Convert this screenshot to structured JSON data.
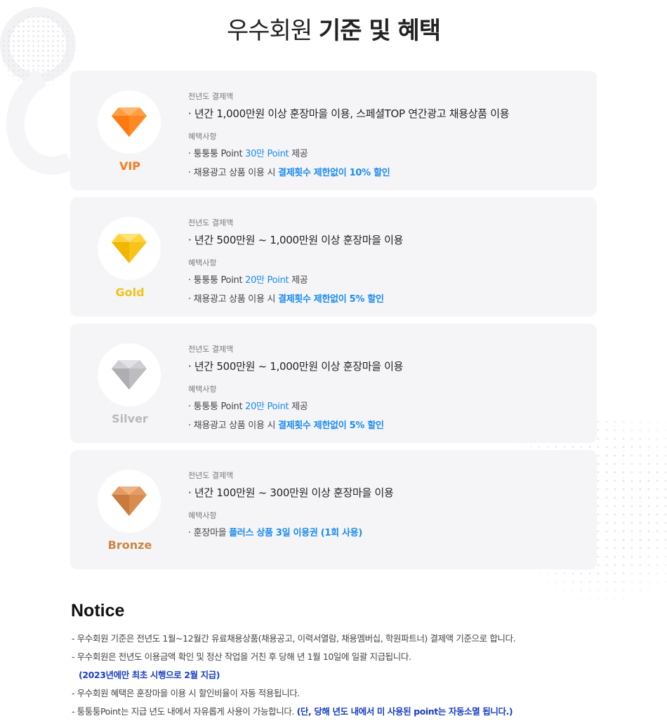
{
  "page": {
    "title_light": "우수회원",
    "title_bold": "기준 및 혜택"
  },
  "tiers": [
    {
      "grade": "VIP",
      "color": "#f57c1f",
      "gem_icon": "diamond-icon",
      "label_payment": "전년도 결제액",
      "criteria": "· 년간 1,000만원 이상 훈장마을 이용, 스페셜TOP 연간광고 채용상품 이용",
      "label_benefit": "혜택사항",
      "benefit1": {
        "prefix": "· 퉁퉁퉁 Point ",
        "highlight": "30만 Point",
        "suffix": " 제공"
      },
      "benefit2": {
        "prefix": "· 채용광고 상품 이용 시 ",
        "highlight": "결제횟수 제한없이 10% 할인",
        "suffix": ""
      }
    },
    {
      "grade": "Gold",
      "color": "#f2c218",
      "gem_icon": "diamond-icon",
      "label_payment": "전년도 결제액",
      "criteria": "· 년간 500만원 ~ 1,000만원 이상 훈장마을 이용",
      "label_benefit": "혜택사항",
      "benefit1": {
        "prefix": "· 퉁퉁퉁 Point ",
        "highlight": "20만 Point",
        "suffix": " 제공"
      },
      "benefit2": {
        "prefix": "· 채용광고 상품 이용 시 ",
        "highlight": "결제횟수 제한없이 5% 할인",
        "suffix": ""
      }
    },
    {
      "grade": "Silver",
      "color": "#b9b9bd",
      "gem_icon": "diamond-icon",
      "label_payment": "전년도 결제액",
      "criteria": "· 년간 500만원 ~ 1,000만원 이상 훈장마을 이용",
      "label_benefit": "혜택사항",
      "benefit1": {
        "prefix": "· 퉁퉁퉁 Point ",
        "highlight": "20만 Point",
        "suffix": " 제공"
      },
      "benefit2": {
        "prefix": "· 채용광고 상품 이용 시 ",
        "highlight": "결제횟수 제한없이 5% 할인",
        "suffix": ""
      }
    },
    {
      "grade": "Bronze",
      "color": "#cf8544",
      "gem_icon": "diamond-icon",
      "label_payment": "전년도 결제액",
      "criteria": "· 년간 100만원 ~ 300만원 이상 훈장마을 이용",
      "label_benefit": "혜택사항",
      "benefit1": {
        "prefix": "· 훈장마을 ",
        "highlight": "플러스 상품 3일 이용권 (1회 사용)",
        "suffix": ""
      }
    }
  ],
  "notice": {
    "title": "Notice",
    "line1": "- 우수회원 기준은 전년도 1월~12월간 유료채용상품(채용공고, 이력서열람, 채용멤버십, 학원파트너) 결제액 기준으로 합니다.",
    "line2": "- 우수회원은 전년도 이용금액 확인 및 정산 작업을 거친 후 당해 년 1월 10일에 일괄 지급됩니다.",
    "line2_note": "(2023년에만 최초 시행으로 2월 지급)",
    "line3": "- 우수회원 혜택은 훈장마을 이용 시 할인비율이 자동 적용됩니다.",
    "line4_prefix": "- 퉁퉁퉁Point는 지급 년도 내에서 자유롭게 사용이 가능합니다. ",
    "line4_highlight": "(단, 당해 년도 내에서 미 사용된 point는  자동소멸 됩니다.)"
  }
}
